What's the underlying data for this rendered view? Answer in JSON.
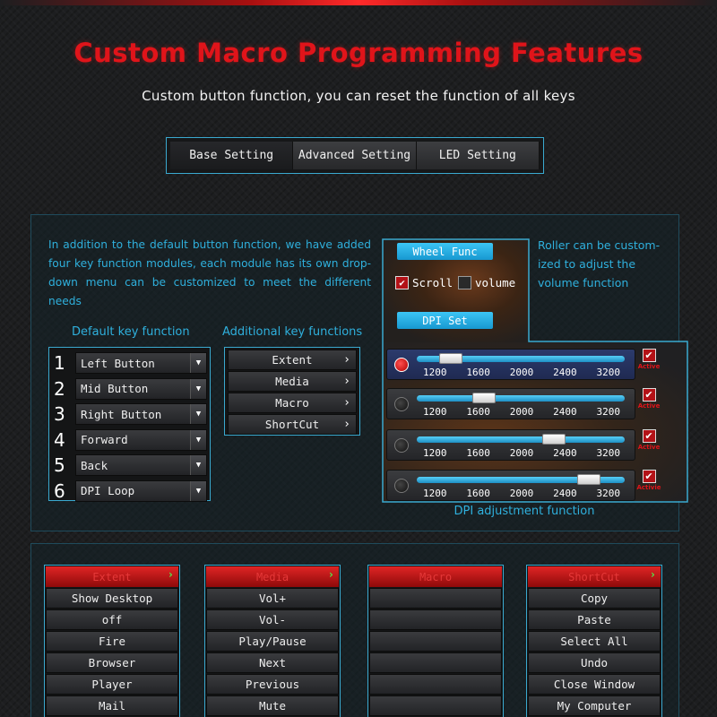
{
  "header": {
    "title": "Custom Macro Programming Features",
    "subtitle": "Custom button function, you can reset the function of all keys"
  },
  "tabs": [
    {
      "label": "Base Setting",
      "active": true
    },
    {
      "label": "Advanced Setting",
      "active": false
    },
    {
      "label": "LED Setting",
      "active": false
    }
  ],
  "intro_text": "In addition to the default button function, we have added four key function modules, each module has its own drop-down menu can be customized to meet the different needs",
  "roller_note": "Roller can be custom-ized to adjust the volume function",
  "default_keys": {
    "label": "Default key function",
    "items": [
      {
        "num": "1",
        "value": "Left Button"
      },
      {
        "num": "2",
        "value": "Mid Button"
      },
      {
        "num": "3",
        "value": "Right Button"
      },
      {
        "num": "4",
        "value": "Forward"
      },
      {
        "num": "5",
        "value": "Back"
      },
      {
        "num": "6",
        "value": "DPI Loop"
      }
    ],
    "dropdown_glyph": "▼"
  },
  "additional_keys": {
    "label": "Additional key functions",
    "items": [
      "Extent",
      "Media",
      "Macro",
      "ShortCut"
    ],
    "arrow_glyph": "›"
  },
  "wheel": {
    "tag": "Wheel Func",
    "scroll_label": "Scroll",
    "scroll_checked": true,
    "volume_label": "volume",
    "volume_checked": false
  },
  "dpi": {
    "tag": "DPI Set",
    "ticks": [
      "1200",
      "1600",
      "2000",
      "2400",
      "3200"
    ],
    "rows": [
      {
        "selected": true,
        "thumb_fraction": 0.12,
        "active_label": "Active",
        "active_checked": true
      },
      {
        "selected": false,
        "thumb_fraction": 0.3,
        "active_label": "Active",
        "active_checked": true
      },
      {
        "selected": false,
        "thumb_fraction": 0.68,
        "active_label": "Active",
        "active_checked": true
      },
      {
        "selected": false,
        "thumb_fraction": 0.87,
        "active_label": "Activie",
        "active_checked": true
      }
    ],
    "caption": "DPI adjustment function"
  },
  "modules": [
    {
      "header": "Extent",
      "items": [
        "Show Desktop",
        "off",
        "Fire",
        "Browser",
        "Player",
        "Mail"
      ]
    },
    {
      "header": "Media",
      "items": [
        "Vol+",
        "Vol-",
        "Play/Pause",
        "Next",
        "Previous",
        "Mute"
      ]
    },
    {
      "header": "Macro",
      "items": [
        "",
        "",
        "",
        "",
        "",
        ""
      ]
    },
    {
      "header": "ShortCut",
      "items": [
        "Copy",
        "Paste",
        "Select All",
        "Undo",
        "Close Window",
        "My Computer"
      ]
    }
  ],
  "colors": {
    "title_red": "#e0141a",
    "accent_blue": "#2fb0dd",
    "frame_blue": "#3aa9cf",
    "slider_blue": "#1e8fc4"
  }
}
